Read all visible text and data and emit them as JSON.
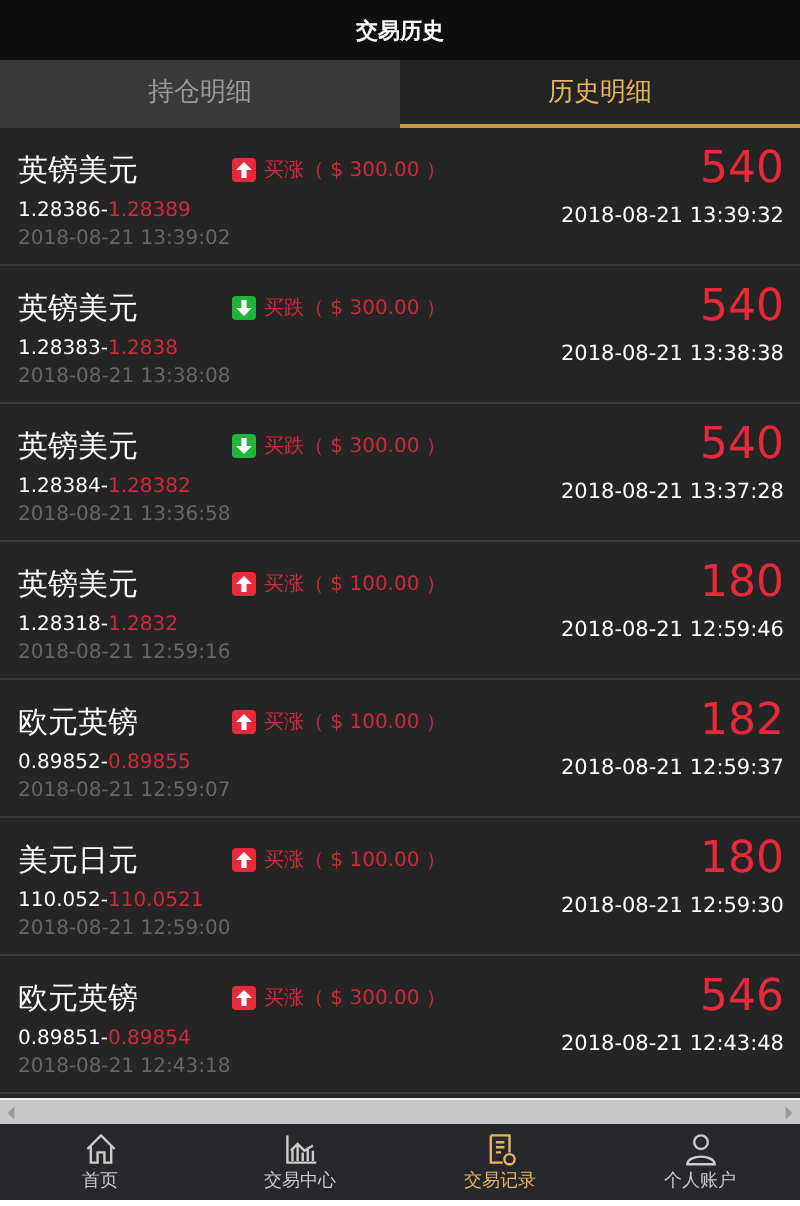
{
  "header": {
    "title": "交易历史"
  },
  "tabs": [
    {
      "label": "持仓明细",
      "selected": false
    },
    {
      "label": "历史明细",
      "selected": true
    }
  ],
  "trades": [
    {
      "pair": "英镑美元",
      "kind": "up",
      "label": "买涨（ $ 300.00 ）",
      "open_price": "1.28386-",
      "close_price": "1.28389",
      "open_time": "2018-08-21 13:39:02",
      "profit": "540",
      "close_time": "2018-08-21 13:39:32"
    },
    {
      "pair": "英镑美元",
      "kind": "down",
      "label": "买跌（ $ 300.00 ）",
      "open_price": "1.28383-",
      "close_price": "1.2838",
      "open_time": "2018-08-21 13:38:08",
      "profit": "540",
      "close_time": "2018-08-21 13:38:38"
    },
    {
      "pair": "英镑美元",
      "kind": "down",
      "label": "买跌（ $ 300.00 ）",
      "open_price": "1.28384-",
      "close_price": "1.28382",
      "open_time": "2018-08-21 13:36:58",
      "profit": "540",
      "close_time": "2018-08-21 13:37:28"
    },
    {
      "pair": "英镑美元",
      "kind": "up",
      "label": "买涨（ $ 100.00 ）",
      "open_price": "1.28318-",
      "close_price": "1.2832",
      "open_time": "2018-08-21 12:59:16",
      "profit": "180",
      "close_time": "2018-08-21 12:59:46"
    },
    {
      "pair": "欧元英镑",
      "kind": "up",
      "label": "买涨（ $ 100.00 ）",
      "open_price": "0.89852-",
      "close_price": "0.89855",
      "open_time": "2018-08-21 12:59:07",
      "profit": "182",
      "close_time": "2018-08-21 12:59:37"
    },
    {
      "pair": "美元日元",
      "kind": "up",
      "label": "买涨（ $ 100.00 ）",
      "open_price": "110.052-",
      "close_price": "110.0521",
      "open_time": "2018-08-21 12:59:00",
      "profit": "180",
      "close_time": "2018-08-21 12:59:30"
    },
    {
      "pair": "欧元英镑",
      "kind": "up",
      "label": "买涨（ $ 300.00 ）",
      "open_price": "0.89851-",
      "close_price": "0.89854",
      "open_time": "2018-08-21 12:43:18",
      "profit": "546",
      "close_time": "2018-08-21 12:43:48"
    }
  ],
  "nav": [
    {
      "label": "首页",
      "kind": "home",
      "selected": false
    },
    {
      "label": "交易中心",
      "kind": "chart",
      "selected": false
    },
    {
      "label": "交易记录",
      "kind": "record",
      "selected": true
    },
    {
      "label": "个人账户",
      "kind": "user",
      "selected": false
    }
  ]
}
